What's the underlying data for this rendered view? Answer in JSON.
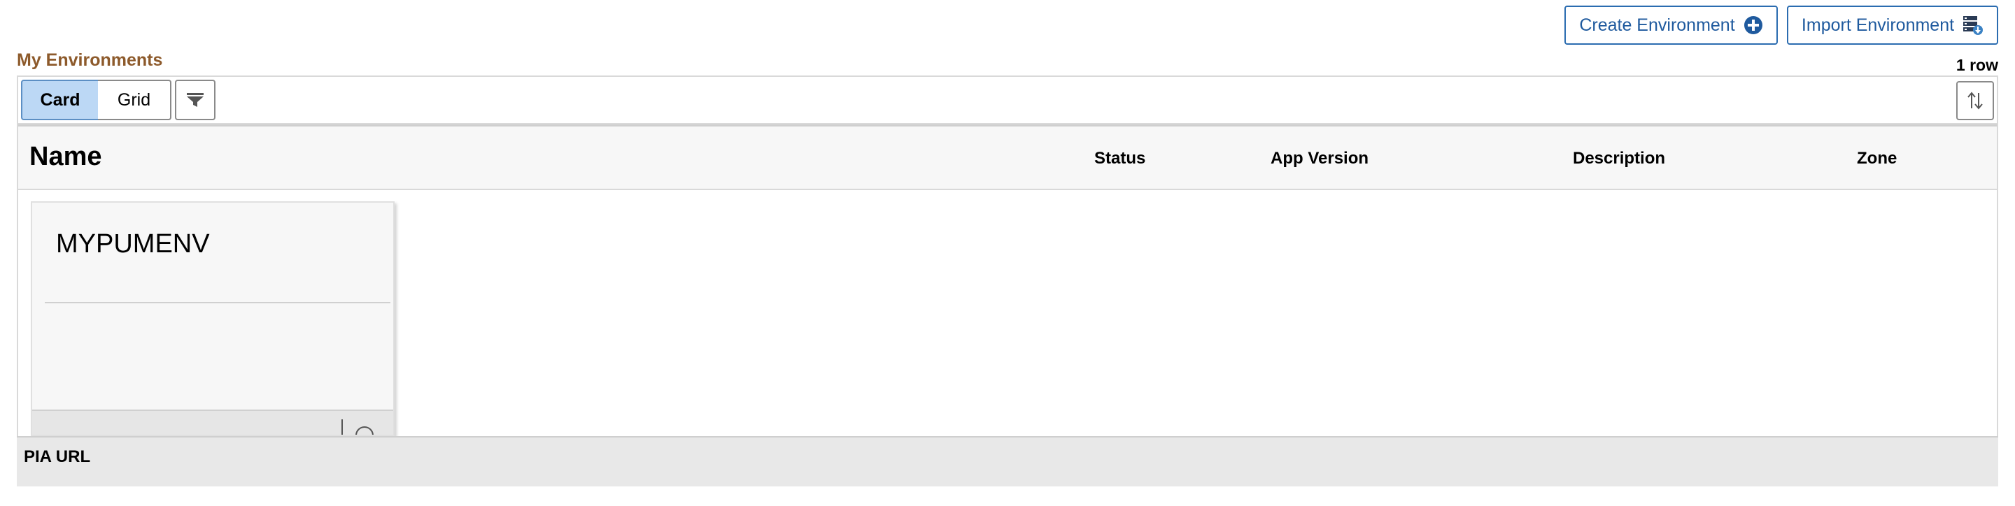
{
  "header": {
    "create_label": "Create Environment",
    "import_label": "Import Environment",
    "create_icon": "plus-circle-icon",
    "import_icon": "server-import-icon"
  },
  "section": {
    "title": "My Environments",
    "row_count": "1 row"
  },
  "toolbar": {
    "view_card": "Card",
    "view_grid": "Grid",
    "selected_view": "Card",
    "filter_icon": "filter-icon",
    "sort_icon": "sort-icon"
  },
  "columns": {
    "name": "Name",
    "status": "Status",
    "app_version": "App Version",
    "description": "Description",
    "zone": "Zone"
  },
  "cards": [
    {
      "title": "MYPUMENV"
    }
  ],
  "footer": {
    "label": "PIA URL"
  },
  "colors": {
    "accent_blue": "#1f5a9e",
    "section_title": "#8d5a2b",
    "selected_segment_bg": "#bcd8f5"
  }
}
